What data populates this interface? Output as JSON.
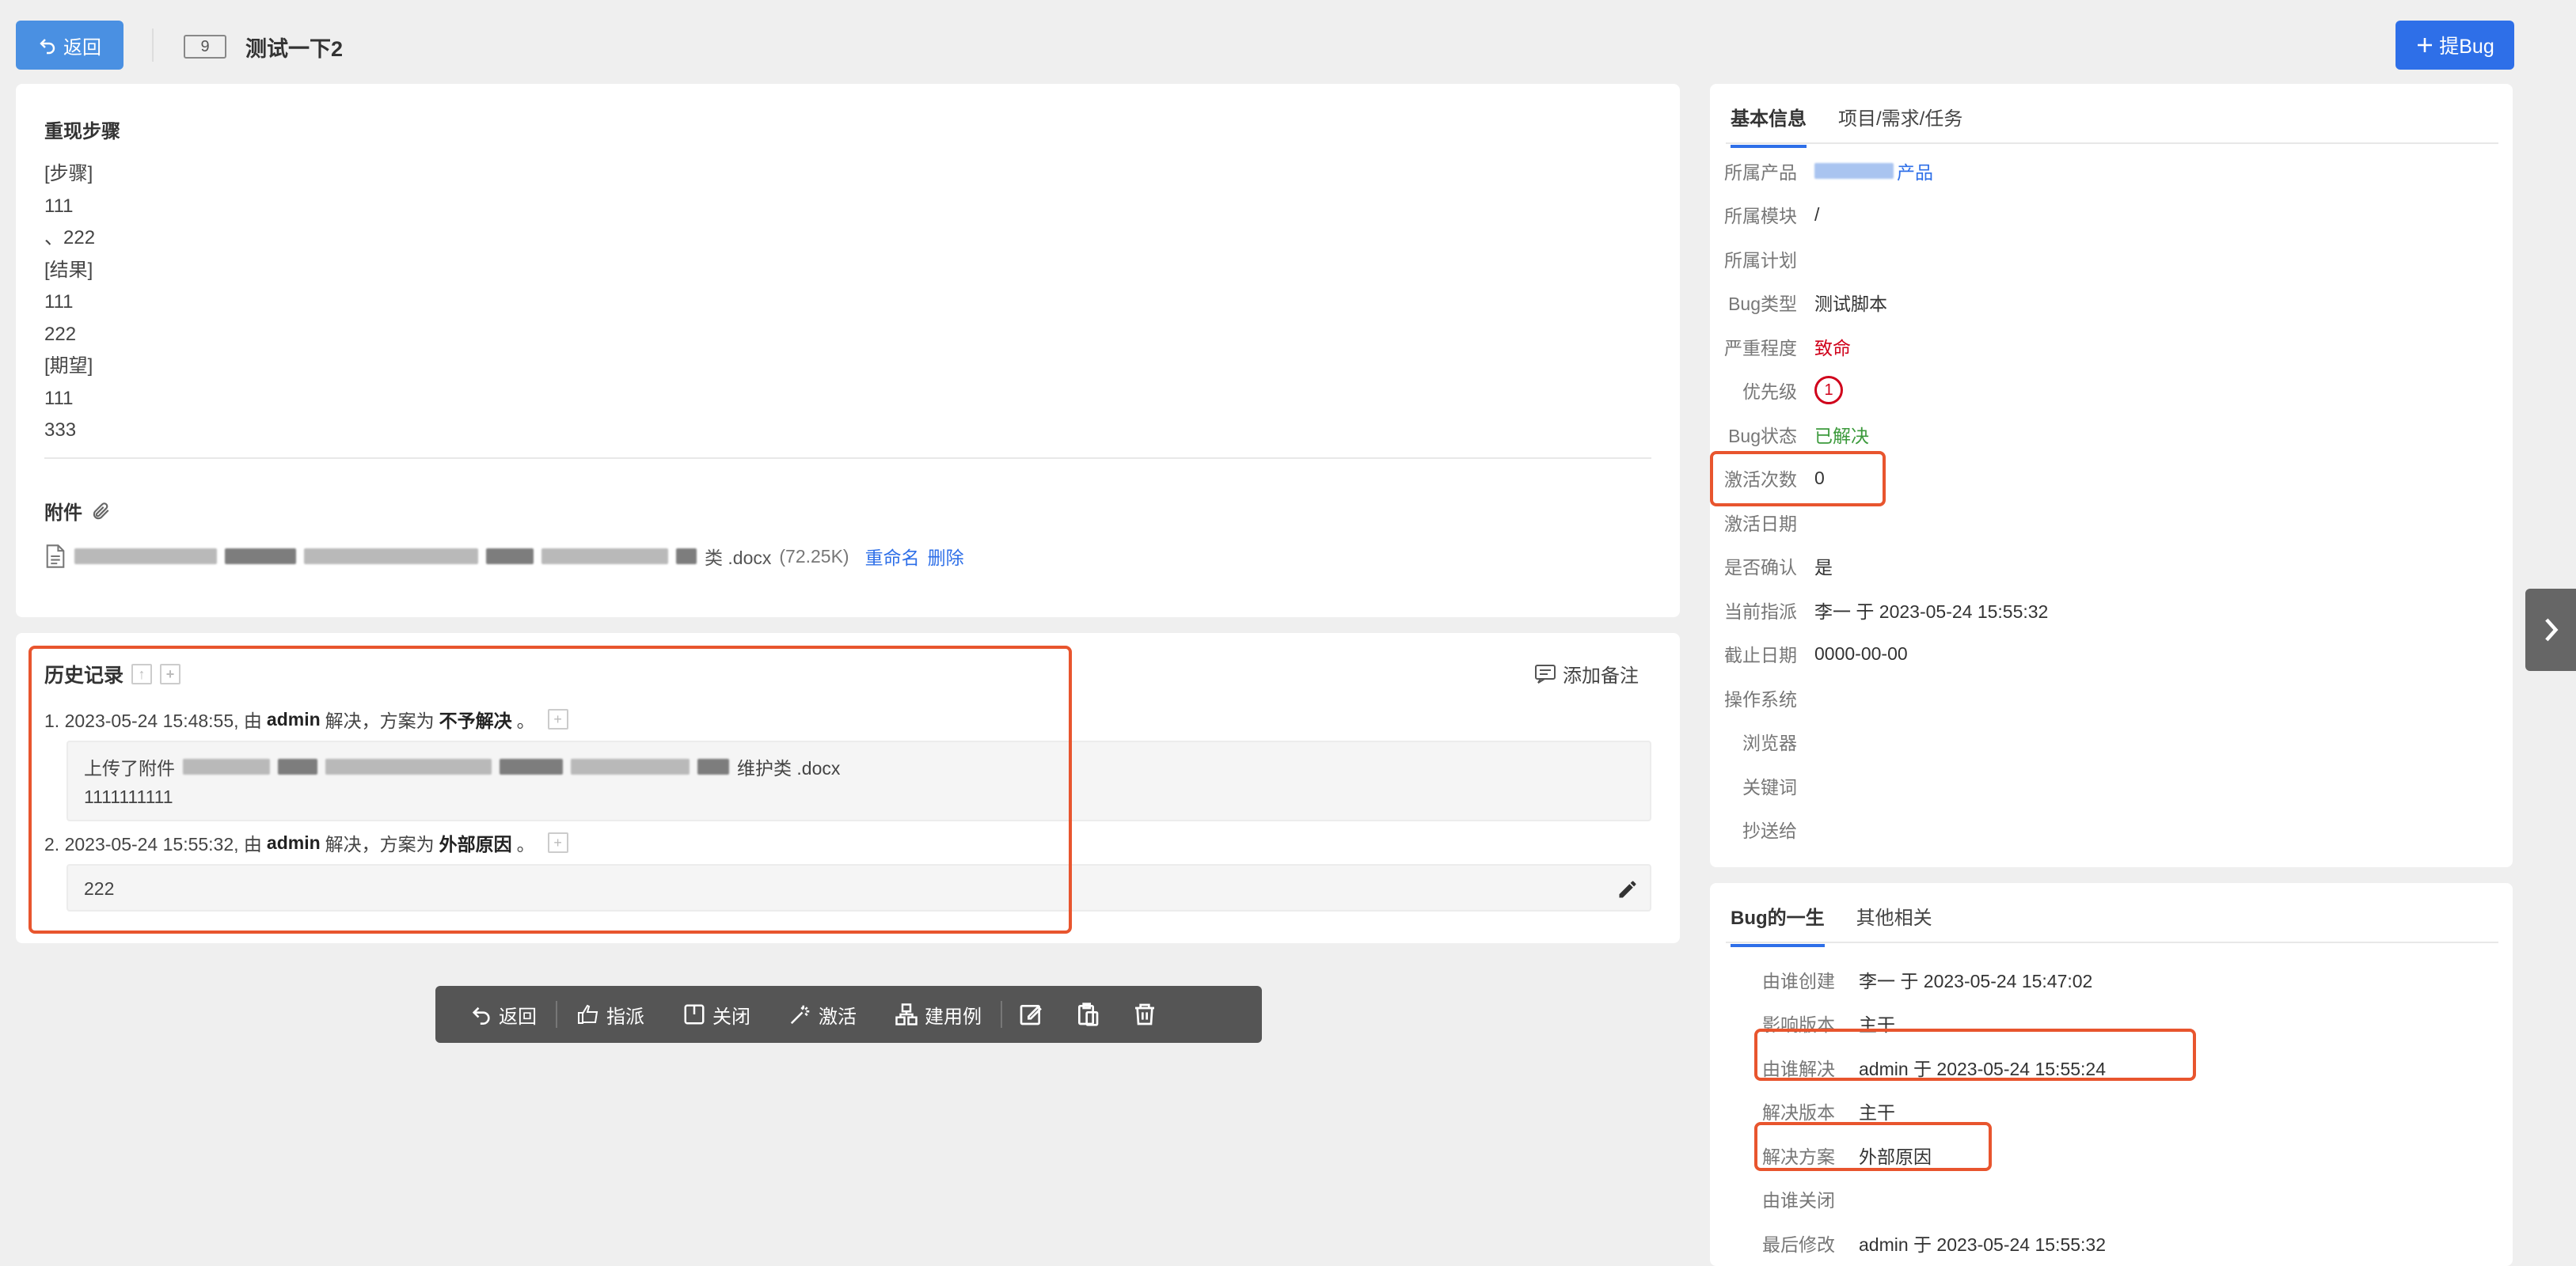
{
  "header": {
    "back_label": "返回",
    "bug_id": "9",
    "bug_title": "测试一下2",
    "add_bug_label": "提Bug"
  },
  "steps": {
    "title": "重现步骤",
    "lines": [
      "[步骤]",
      "111",
      "、222",
      "[结果]",
      "111",
      "222",
      "[期望]",
      "111",
      "333"
    ]
  },
  "attachments": {
    "title": "附件",
    "file_suffix": "类 .docx",
    "file_size": "(72.25K)",
    "rename_label": "重命名",
    "delete_label": "删除"
  },
  "history": {
    "title": "历史记录",
    "add_note_label": "添加备注",
    "items": [
      {
        "text_prefix": "1. 2023-05-24 15:48:55, 由 ",
        "actor": "admin",
        "action": " 解决，方案为 ",
        "solution": "不予解决",
        "end": " 。",
        "box_lines": [
          "上传了附件",
          "维护类 .docx",
          "1111111111"
        ]
      },
      {
        "text_prefix": "2. 2023-05-24 15:55:32, 由 ",
        "actor": "admin",
        "action": " 解决，方案为 ",
        "solution": "外部原因",
        "end": " 。",
        "box_lines": [
          "222"
        ]
      }
    ]
  },
  "toolbar": {
    "back": "返回",
    "assign": "指派",
    "close": "关闭",
    "activate": "激活",
    "create_case": "建用例"
  },
  "info_panel": {
    "tabs": [
      "基本信息",
      "项目/需求/任务"
    ],
    "rows": [
      {
        "label": "所属产品",
        "value": "产品"
      },
      {
        "label": "所属模块",
        "value": "/"
      },
      {
        "label": "所属计划",
        "value": ""
      },
      {
        "label": "Bug类型",
        "value": "测试脚本"
      },
      {
        "label": "严重程度",
        "value": "致命"
      },
      {
        "label": "优先级",
        "value": "1"
      },
      {
        "label": "Bug状态",
        "value": "已解决"
      },
      {
        "label": "激活次数",
        "value": "0"
      },
      {
        "label": "激活日期",
        "value": ""
      },
      {
        "label": "是否确认",
        "value": "是"
      },
      {
        "label": "当前指派",
        "value": "李一 于 2023-05-24 15:55:32"
      },
      {
        "label": "截止日期",
        "value": "0000-00-00"
      },
      {
        "label": "操作系统",
        "value": ""
      },
      {
        "label": "浏览器",
        "value": ""
      },
      {
        "label": "关键词",
        "value": ""
      },
      {
        "label": "抄送给",
        "value": ""
      }
    ]
  },
  "life_panel": {
    "tabs": [
      "Bug的一生",
      "其他相关"
    ],
    "rows": [
      {
        "label": "由谁创建",
        "value": "李一 于 2023-05-24 15:47:02"
      },
      {
        "label": "影响版本",
        "value": "主干"
      },
      {
        "label": "由谁解决",
        "value": "admin 于 2023-05-24 15:55:24"
      },
      {
        "label": "解决版本",
        "value": "主干"
      },
      {
        "label": "解决方案",
        "value": "外部原因"
      },
      {
        "label": "由谁关闭",
        "value": ""
      },
      {
        "label": "最后修改",
        "value": "admin 于 2023-05-24 15:55:32"
      }
    ]
  },
  "colors": {
    "primary": "#2e6fe8",
    "highlight_frame": "#e8552e",
    "severity": "#d0021b",
    "resolved": "#3c9a3c"
  }
}
